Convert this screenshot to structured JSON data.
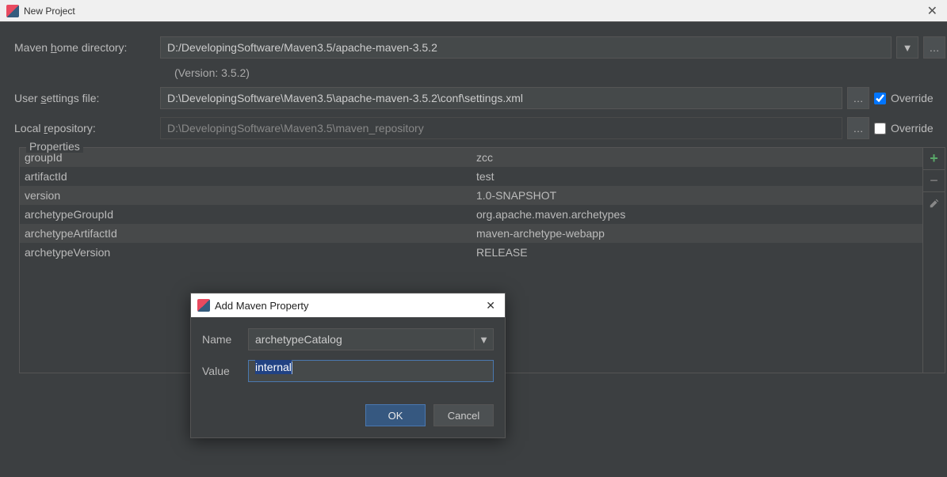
{
  "window": {
    "title": "New Project"
  },
  "form": {
    "home_label_pre": "Maven ",
    "home_label_u": "h",
    "home_label_post": "ome directory:",
    "home_path": "D:/DevelopingSoftware/Maven3.5/apache-maven-3.5.2",
    "version_note": "(Version: 3.5.2)",
    "settings_label_pre": "User ",
    "settings_label_u": "s",
    "settings_label_post": "ettings file:",
    "settings_path": "D:\\DevelopingSoftware\\Maven3.5\\apache-maven-3.5.2\\conf\\settings.xml",
    "repo_label_pre": "Local ",
    "repo_label_u": "r",
    "repo_label_post": "epository:",
    "repo_path": "D:\\DevelopingSoftware\\Maven3.5\\maven_repository",
    "override_label": "Override",
    "browse_glyph": "…"
  },
  "props": {
    "legend": "Properties",
    "rows": [
      {
        "k": "groupId",
        "v": "zcc"
      },
      {
        "k": "artifactId",
        "v": "test"
      },
      {
        "k": "version",
        "v": "1.0-SNAPSHOT"
      },
      {
        "k": "archetypeGroupId",
        "v": "org.apache.maven.archetypes"
      },
      {
        "k": "archetypeArtifactId",
        "v": "maven-archetype-webapp"
      },
      {
        "k": "archetypeVersion",
        "v": "RELEASE"
      }
    ],
    "add_glyph": "+",
    "remove_glyph": "−"
  },
  "modal": {
    "title": "Add Maven Property",
    "name_label": "Name",
    "name_value": "archetypeCatalog",
    "value_label": "Value",
    "value_value": "internal",
    "ok": "OK",
    "cancel": "Cancel"
  }
}
